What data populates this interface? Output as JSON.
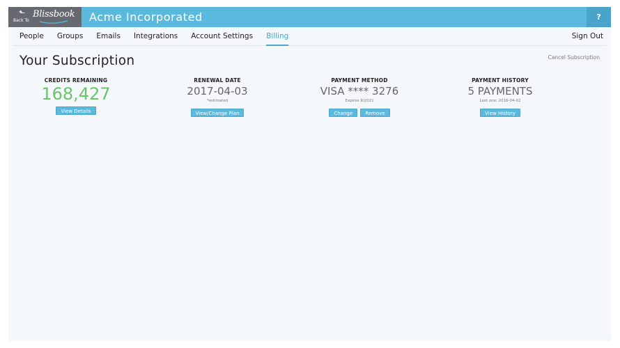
{
  "header": {
    "back_label": "Back To",
    "logo_text": "Blissbook",
    "company": "Acme Incorporated",
    "help_label": "?"
  },
  "nav": {
    "items": [
      {
        "label": "People"
      },
      {
        "label": "Groups"
      },
      {
        "label": "Emails"
      },
      {
        "label": "Integrations"
      },
      {
        "label": "Account Settings"
      },
      {
        "label": "Billing",
        "active": true
      }
    ],
    "signout": "Sign Out"
  },
  "page": {
    "title": "Your Subscription",
    "cancel_link": "Cancel Subscription"
  },
  "stats": {
    "credits": {
      "label": "CREDITS REMAINING",
      "value": "168,427",
      "button": "View Details"
    },
    "renewal": {
      "label": "RENEWAL DATE",
      "value": "2017-04-03",
      "note": "*estimated",
      "button": "View/Change Plan"
    },
    "payment": {
      "label": "PAYMENT METHOD",
      "value": "VISA **** 3276",
      "note": "Expires 9/2021",
      "button_change": "Change",
      "button_remove": "Remove"
    },
    "history": {
      "label": "PAYMENT HISTORY",
      "value": "5 PAYMENTS",
      "note": "Last one: 2016-04-02",
      "button": "View History"
    }
  },
  "colors": {
    "accent": "#5bb9de",
    "logo_bg": "#666a70",
    "credits_green": "#6cc36b",
    "active_nav": "#4ba6cc"
  }
}
